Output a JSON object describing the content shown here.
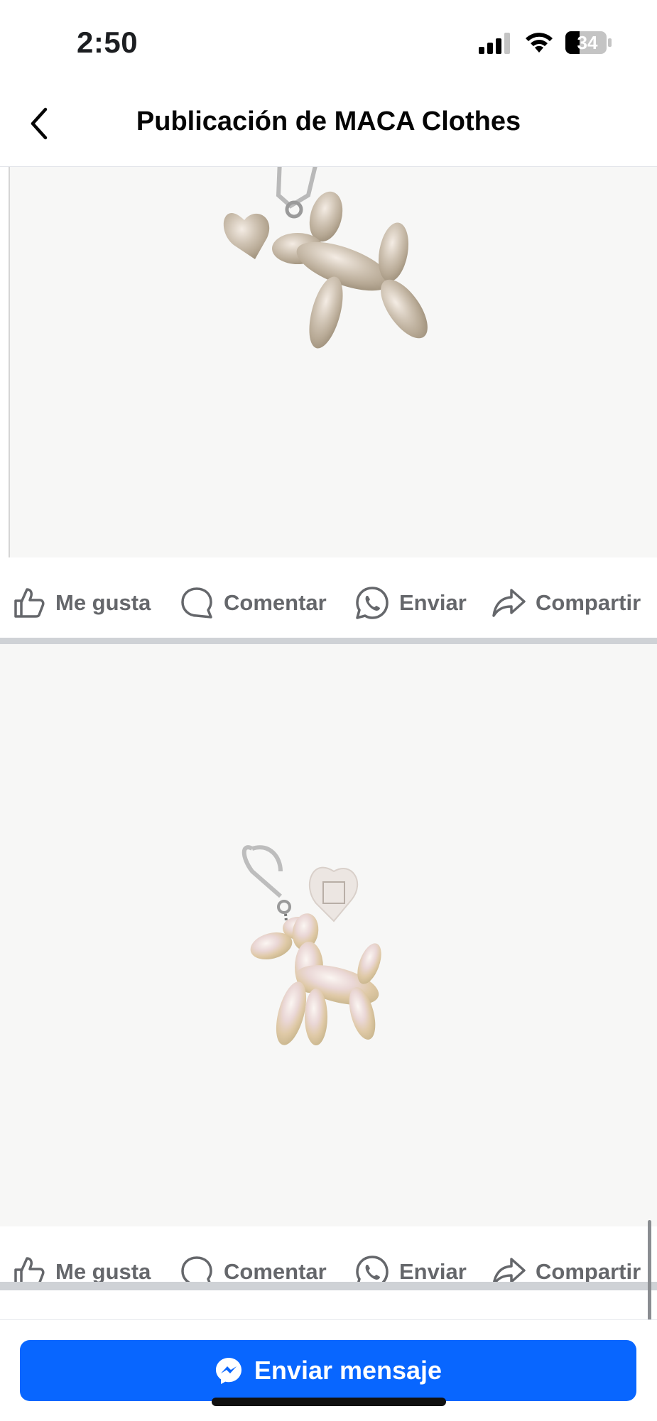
{
  "status_bar": {
    "time": "2:50",
    "battery": "34"
  },
  "header": {
    "title": "Publicación de MACA Clothes"
  },
  "posts": [
    {
      "actions": {
        "like": "Me gusta",
        "comment": "Comentar",
        "send": "Enviar",
        "share": "Compartir"
      }
    },
    {
      "actions": {
        "like": "Me gusta",
        "comment": "Comentar",
        "send": "Enviar",
        "share": "Compartir"
      }
    }
  ],
  "footer": {
    "message_button": "Enviar mensaje"
  },
  "colors": {
    "accent": "#0866ff",
    "action_text": "#65676b"
  }
}
